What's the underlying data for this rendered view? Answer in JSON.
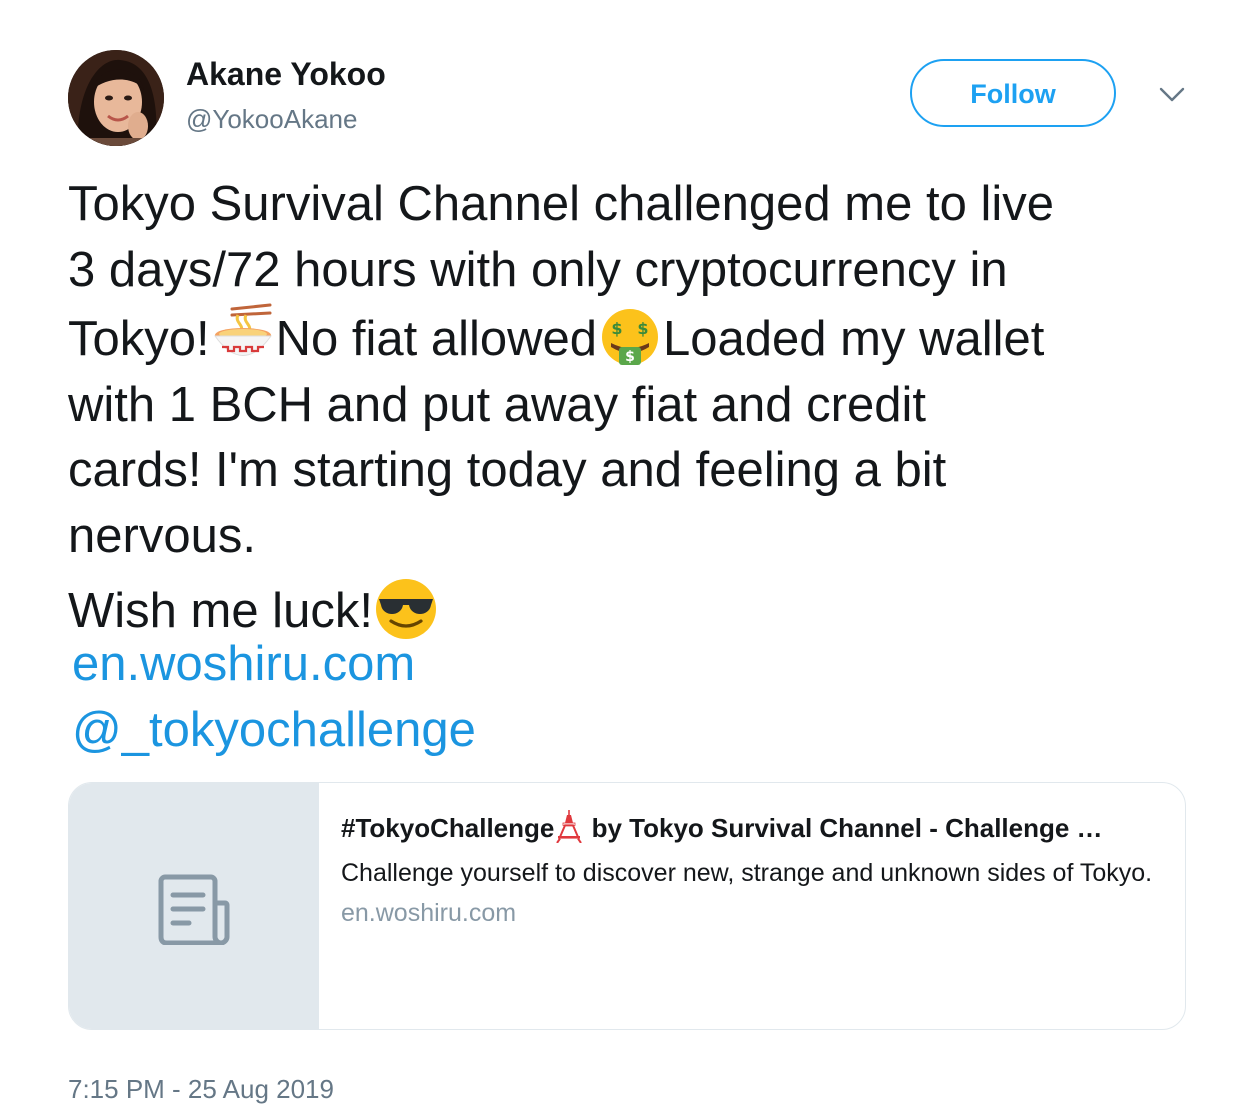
{
  "user": {
    "display_name": "Akane Yokoo",
    "handle": "@YokooAkane"
  },
  "actions": {
    "follow_label": "Follow"
  },
  "tweet": {
    "line1": "Tokyo Survival Channel challenged me to live",
    "line2": "3 days/72 hours with only cryptocurrency in",
    "line3a": "Tokyo!",
    "line3b": "No fiat allowed",
    "line3c": "Loaded my wallet",
    "line4": "with 1 BCH and put away fiat and credit",
    "line5": "cards! I'm starting today and feeling a bit",
    "line6": "nervous.",
    "line7": "Wish me luck!",
    "link1": "en.woshiru.com",
    "link2": "@_tokyochallenge",
    "timestamp": "7:15 PM - 25 Aug 2019"
  },
  "card": {
    "title_a": "#TokyoChallenge",
    "title_b": " by Tokyo Survival Channel - Challenge …",
    "description": "Challenge yourself to discover new, strange and unknown sides of Tokyo.",
    "domain": "en.woshiru.com"
  },
  "icons": {
    "ramen": "ramen-bowl-emoji",
    "money_face": "money-mouth-face-emoji",
    "sunglasses": "smiling-face-with-sunglasses-emoji",
    "tower": "tokyo-tower-emoji",
    "document": "document-icon",
    "chevron": "chevron-down-icon"
  },
  "colors": {
    "accent": "#1da1f2",
    "link": "#1b95e0",
    "secondary_text": "#657786",
    "card_border": "#e1e8ed"
  }
}
